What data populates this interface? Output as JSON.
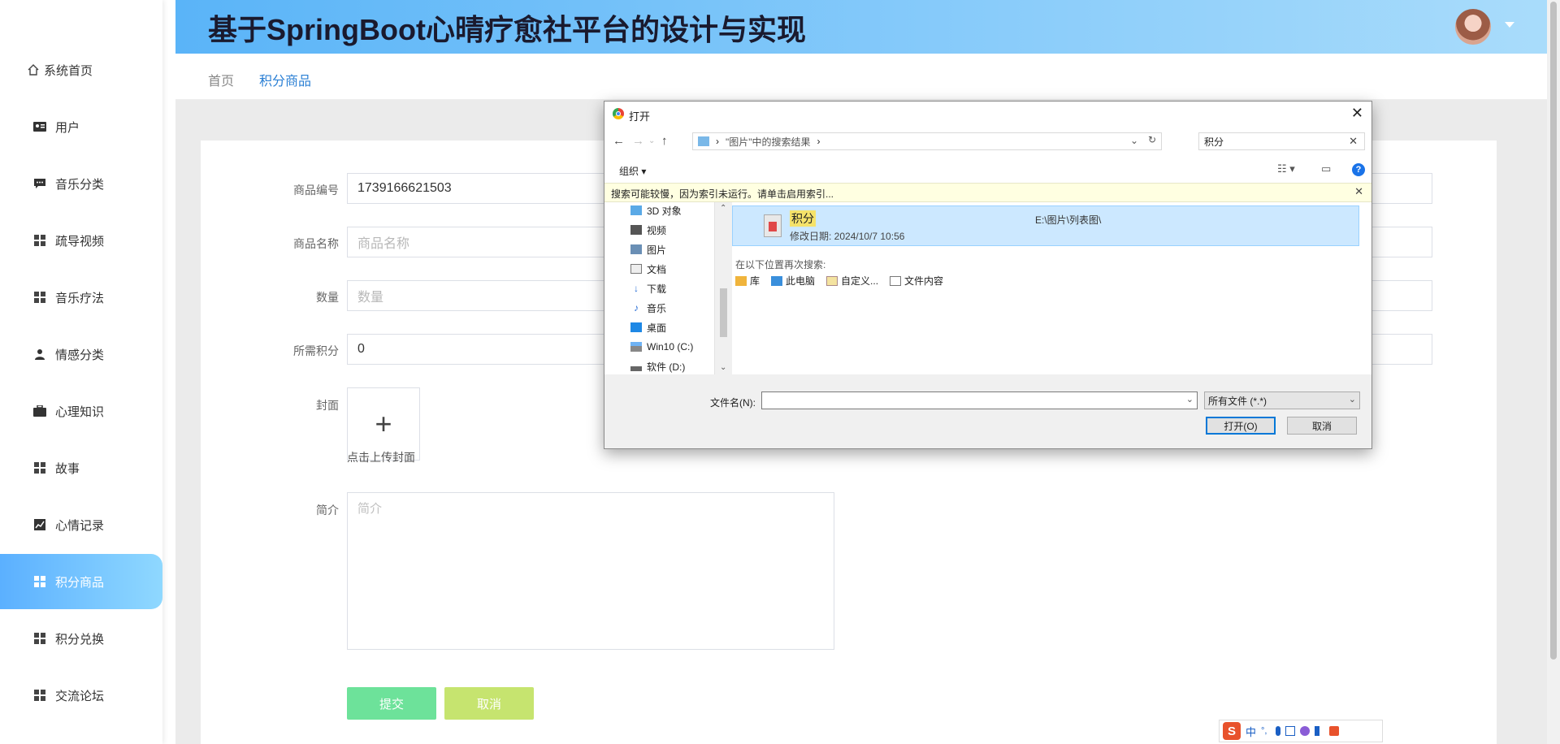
{
  "header": {
    "title": "基于SpringBoot心晴疗愈社平台的设计与实现"
  },
  "sidebar": {
    "items": [
      {
        "label": "系统首页",
        "icon": "home-icon"
      },
      {
        "label": "用户",
        "icon": "user-card-icon"
      },
      {
        "label": "音乐分类",
        "icon": "chat-icon"
      },
      {
        "label": "疏导视频",
        "icon": "grid-icon"
      },
      {
        "label": "音乐疗法",
        "icon": "grid-icon"
      },
      {
        "label": "情感分类",
        "icon": "person-icon"
      },
      {
        "label": "心理知识",
        "icon": "briefcase-icon"
      },
      {
        "label": "故事",
        "icon": "grid-icon"
      },
      {
        "label": "心情记录",
        "icon": "chart-icon"
      },
      {
        "label": "积分商品",
        "icon": "grid-icon",
        "active": true
      },
      {
        "label": "积分兑换",
        "icon": "grid-icon"
      },
      {
        "label": "交流论坛",
        "icon": "grid-icon"
      }
    ],
    "active_color": "#5bb0ff"
  },
  "breadcrumb": {
    "home": "首页",
    "current": "积分商品"
  },
  "form": {
    "code": {
      "label": "商品编号",
      "value": "1739166621503"
    },
    "name": {
      "label": "商品名称",
      "placeholder": "商品名称"
    },
    "quantity": {
      "label": "数量",
      "placeholder": "数量"
    },
    "points": {
      "label": "所需积分",
      "value": "0"
    },
    "cover": {
      "label": "封面",
      "hint": "点击上传封面"
    },
    "intro": {
      "label": "简介",
      "placeholder": "简介"
    },
    "submit": "提交",
    "cancel": "取消"
  },
  "dialog": {
    "title": "打开",
    "path_text": "\"图片\"中的搜索结果",
    "search_value": "积分",
    "organize": "组织",
    "info": "搜索可能较慢，因为索引未运行。请单击启用索引...",
    "tree": [
      "3D 对象",
      "视频",
      "图片",
      "文档",
      "下载",
      "音乐",
      "桌面",
      "Win10 (C:)",
      "软件 (D:)"
    ],
    "result": {
      "name": "积分",
      "date": "修改日期: 2024/10/7 10:56",
      "path": "E:\\图片\\列表图\\"
    },
    "search_again": "在以下位置再次搜索:",
    "locations": [
      "库",
      "此电脑",
      "自定义...",
      "文件内容"
    ],
    "filename_label": "文件名(N):",
    "filter": "所有文件 (*.*)",
    "open": "打开(O)",
    "cancel": "取消"
  },
  "ime": {
    "mode": "中"
  }
}
